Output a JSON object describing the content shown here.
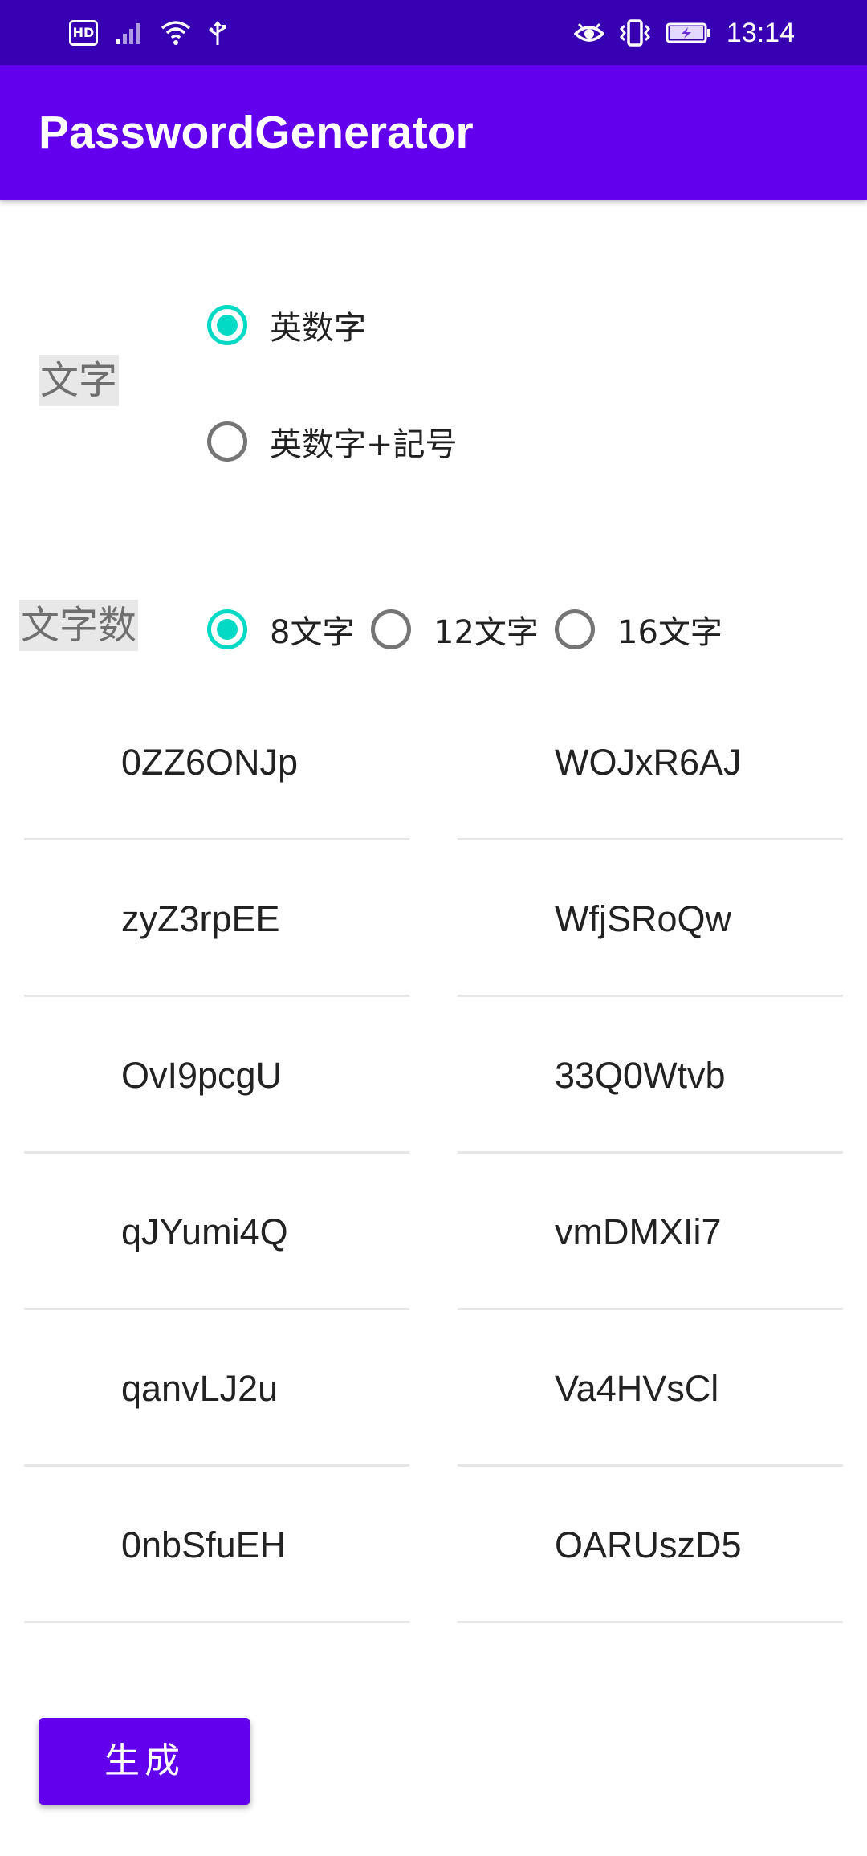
{
  "status_bar": {
    "time": "13:14",
    "left_icons": [
      "hd-icon",
      "signal-icon",
      "wifi-icon",
      "usb-icon"
    ],
    "right_icons": [
      "eye-icon",
      "vibrate-icon",
      "battery-charging-icon"
    ],
    "hd_label": "HD"
  },
  "app_bar": {
    "title": "PasswordGenerator",
    "color": "#6200EE"
  },
  "char_type": {
    "label": "文字",
    "options": [
      {
        "label": "英数字",
        "checked": true
      },
      {
        "label": "英数字+記号",
        "checked": false
      }
    ]
  },
  "char_count": {
    "label": "文字数",
    "options": [
      {
        "label": "8文字",
        "checked": true
      },
      {
        "label": "12文字",
        "checked": false
      },
      {
        "label": "16文字",
        "checked": false
      }
    ]
  },
  "passwords": [
    "0ZZ6ONJp",
    "WOJxR6AJ",
    "zyZ3rpEE",
    "WfjSRoQw",
    "OvI9pcgU",
    "33Q0Wtvb",
    "qJYumi4Q",
    "vmDMXIi7",
    "qanvLJ2u",
    "Va4HVsCl",
    "0nbSfuEH",
    "OARUszD5"
  ],
  "generate_button": {
    "label": "生成"
  },
  "colors": {
    "accent": "#03DAC5",
    "primary": "#6200EE",
    "status_bar": "#3700B3"
  }
}
